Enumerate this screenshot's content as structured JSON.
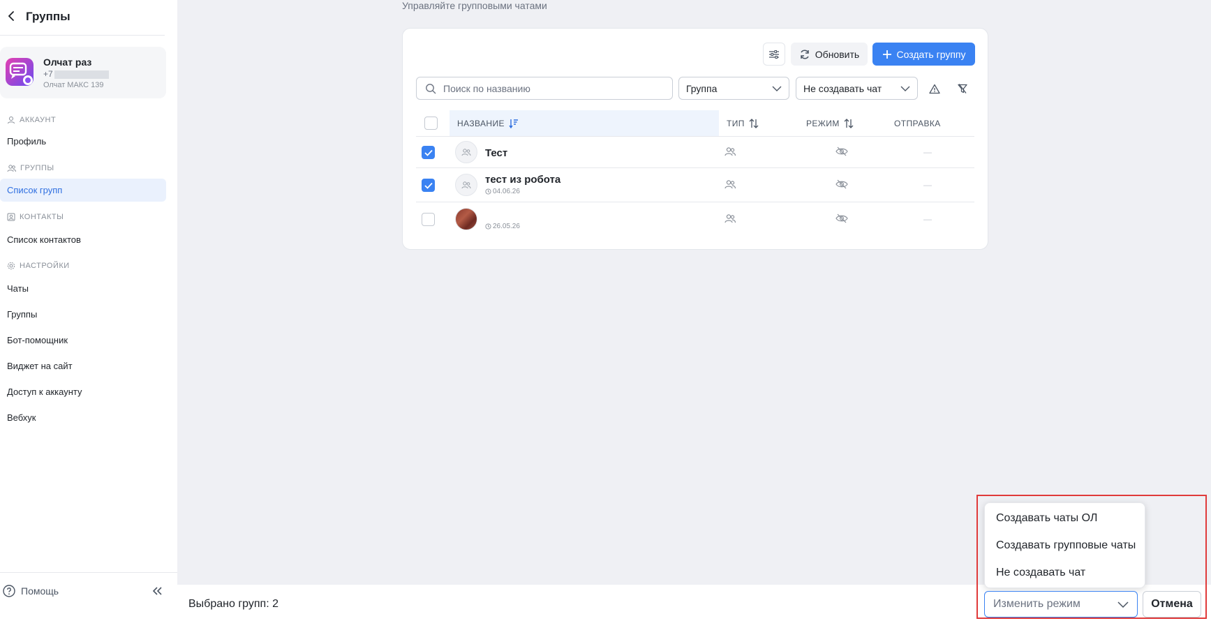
{
  "sidebar": {
    "title": "Группы",
    "account": {
      "name": "Олчат раз",
      "phone": "+7",
      "subtitle": "Олчат МАКС 139"
    },
    "sections": {
      "account": "АККАУНТ",
      "groups": "ГРУППЫ",
      "contacts": "КОНТАКТЫ",
      "settings": "НАСТРОЙКИ"
    },
    "items": {
      "profile": "Профиль",
      "group_list": "Список групп",
      "contact_list": "Список контактов",
      "chats": "Чаты",
      "groups": "Группы",
      "bot": "Бот-помощник",
      "widget": "Виджет на сайт",
      "access": "Доступ к аккаунту",
      "webhook": "Вебхук"
    },
    "help": "Помощь"
  },
  "main": {
    "subtitle": "Управляйте групповыми чатами",
    "toolbar": {
      "refresh_label": "Обновить",
      "create_label": "Создать группу"
    },
    "filters": {
      "search_placeholder": "Поиск по названию",
      "type_value": "Группа",
      "mode_value": "Не создавать чат"
    },
    "table": {
      "columns": {
        "name": "НАЗВАНИЕ",
        "type": "ТИП",
        "mode": "РЕЖИМ",
        "send": "ОТПРАВКА"
      },
      "rows": [
        {
          "name": "Тест",
          "date": "",
          "checked": true,
          "send": "—"
        },
        {
          "name": "тест из робота",
          "date": "04.06.26",
          "checked": true,
          "send": "—"
        },
        {
          "name": "",
          "date": "26.05.26",
          "checked": false,
          "send": "—"
        }
      ]
    }
  },
  "bottom": {
    "selected_text": "Выбрано групп: 2",
    "mode_placeholder": "Изменить режим",
    "cancel_label": "Отмена",
    "menu": [
      "Создавать чаты ОЛ",
      "Создавать групповые чаты",
      "Не создавать чат"
    ]
  },
  "colors": {
    "accent": "#3a82f2",
    "highlight": "#e03a3a"
  }
}
